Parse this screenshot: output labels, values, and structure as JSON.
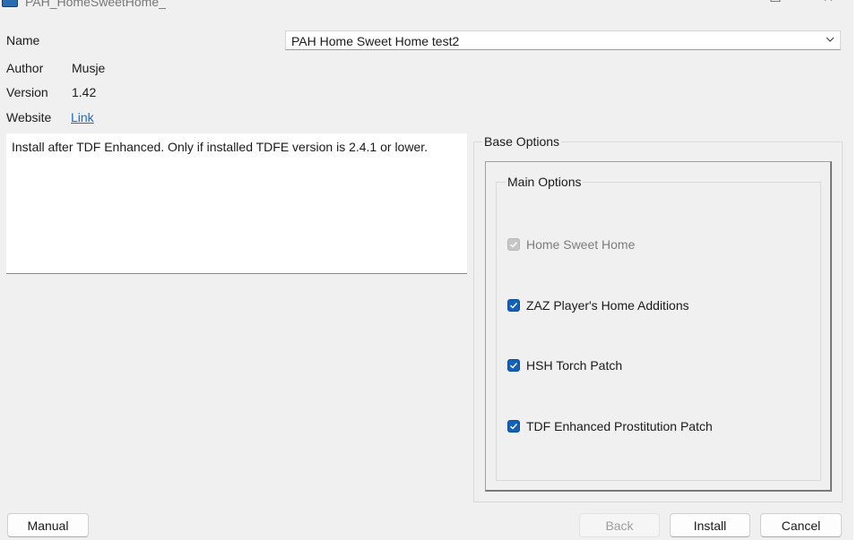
{
  "window": {
    "title": "PAH_HomeSweetHome_",
    "minimize_glyph": "☐",
    "close_glyph": "✕"
  },
  "fields": {
    "name_label": "Name",
    "name_value": "PAH Home Sweet Home test2",
    "author_label": "Author",
    "author_value": "Musje",
    "version_label": "Version",
    "version_value": "1.42",
    "website_label": "Website",
    "website_link": "Link"
  },
  "description": "Install after TDF Enhanced. Only if installed TDFE version is 2.4.1 or lower.",
  "options": {
    "group_title": "Base Options",
    "subgroup_title": "Main Options",
    "items": [
      {
        "label": "Home Sweet Home",
        "checked": true,
        "enabled": false
      },
      {
        "label": "ZAZ Player's Home Additions",
        "checked": true,
        "enabled": true
      },
      {
        "label": "HSH Torch Patch",
        "checked": true,
        "enabled": true
      },
      {
        "label": "TDF Enhanced Prostitution Patch",
        "checked": true,
        "enabled": true
      }
    ]
  },
  "buttons": {
    "manual": "Manual",
    "back": "Back",
    "install": "Install",
    "cancel": "Cancel"
  },
  "colors": {
    "accent": "#1260b8",
    "link": "#1b6ac9",
    "background": "#f0f0f0"
  }
}
